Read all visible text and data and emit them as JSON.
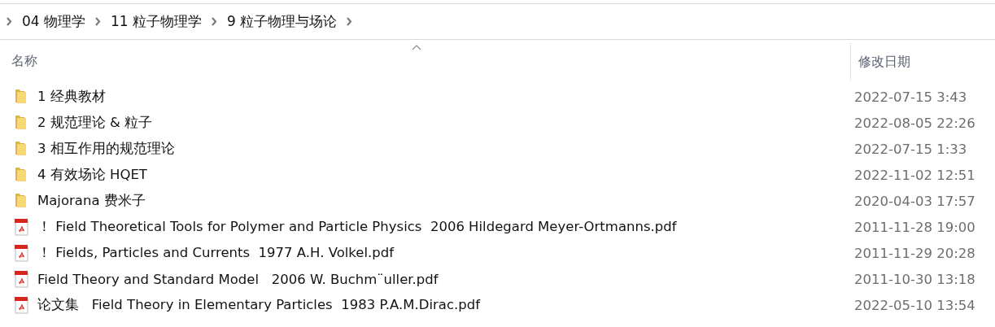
{
  "breadcrumb": [
    {
      "label": "04 物理学"
    },
    {
      "label": "11 粒子物理学"
    },
    {
      "label": "9 粒子物理与场论"
    }
  ],
  "columns": [
    {
      "label": "名称",
      "sorted": true
    },
    {
      "label": "修改日期",
      "sorted": false
    }
  ],
  "rows": [
    {
      "kind": "folder",
      "name": "1 经典教材",
      "modified": "2022-07-15 3:43"
    },
    {
      "kind": "folder",
      "name": "2 规范理论 & 粒子",
      "modified": "2022-08-05 22:26"
    },
    {
      "kind": "folder",
      "name": "3 相互作用的规范理论",
      "modified": "2022-07-15 1:33"
    },
    {
      "kind": "folder",
      "name": "4 有效场论 HQET",
      "modified": "2022-11-02 12:51"
    },
    {
      "kind": "folder",
      "name": "Majorana 费米子",
      "modified": "2020-04-03 17:57"
    },
    {
      "kind": "pdf",
      "name": "！ Field Theoretical Tools for Polymer and Particle Physics  2006 Hildegard Meyer-Ortmanns.pdf",
      "modified": "2011-11-28 19:00"
    },
    {
      "kind": "pdf",
      "name": "！ Fields, Particles and Currents  1977 A.H. Volkel.pdf",
      "modified": "2011-11-29 20:28"
    },
    {
      "kind": "pdf",
      "name": "Field Theory and Standard Model   2006 W. Buchm¨uller.pdf",
      "modified": "2011-10-30 13:18"
    },
    {
      "kind": "pdf",
      "name": "论文集   Field Theory in Elementary Particles  1983 P.A.M.Dirac.pdf",
      "modified": "2022-05-10 13:54"
    }
  ]
}
